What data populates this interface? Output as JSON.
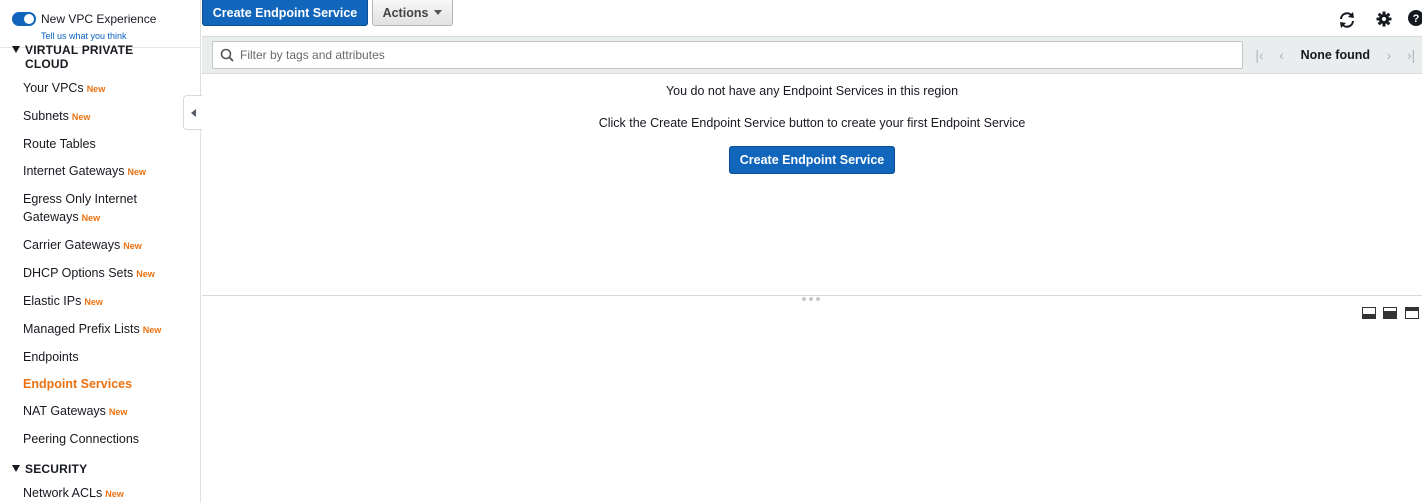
{
  "sidebar": {
    "toggle_label": "New VPC Experience",
    "tell_link": "Tell us what you think",
    "section_vpc": "VIRTUAL PRIVATE CLOUD",
    "new_badge": "New",
    "items": [
      {
        "label": "Your VPCs",
        "new": true
      },
      {
        "label": "Subnets",
        "new": true
      },
      {
        "label": "Route Tables",
        "new": false
      },
      {
        "label": "Internet Gateways",
        "new": true
      },
      {
        "label": "Egress Only Internet",
        "label2": "Gateways",
        "new": true
      },
      {
        "label": "Carrier Gateways",
        "new": true
      },
      {
        "label": "DHCP Options Sets",
        "new": true
      },
      {
        "label": "Elastic IPs",
        "new": true
      },
      {
        "label": "Managed Prefix Lists",
        "new": true
      },
      {
        "label": "Endpoints",
        "new": false
      },
      {
        "label": "Endpoint Services",
        "new": false,
        "active": true
      },
      {
        "label": "NAT Gateways",
        "new": true
      },
      {
        "label": "Peering Connections",
        "new": false
      }
    ],
    "section_security": "SECURITY",
    "security_items": [
      {
        "label": "Network ACLs",
        "new": true
      }
    ]
  },
  "toolbar": {
    "create_label": "Create Endpoint Service",
    "actions_label": "Actions"
  },
  "filter": {
    "placeholder": "Filter by tags and attributes",
    "pager_status": "None found"
  },
  "empty_state": {
    "line1": "You do not have any Endpoint Services in this region",
    "line2": "Click the Create Endpoint Service button to create your first Endpoint Service",
    "create_label": "Create Endpoint Service"
  },
  "colors": {
    "primary": "#1166bb",
    "accent_new": "#ec7211"
  }
}
